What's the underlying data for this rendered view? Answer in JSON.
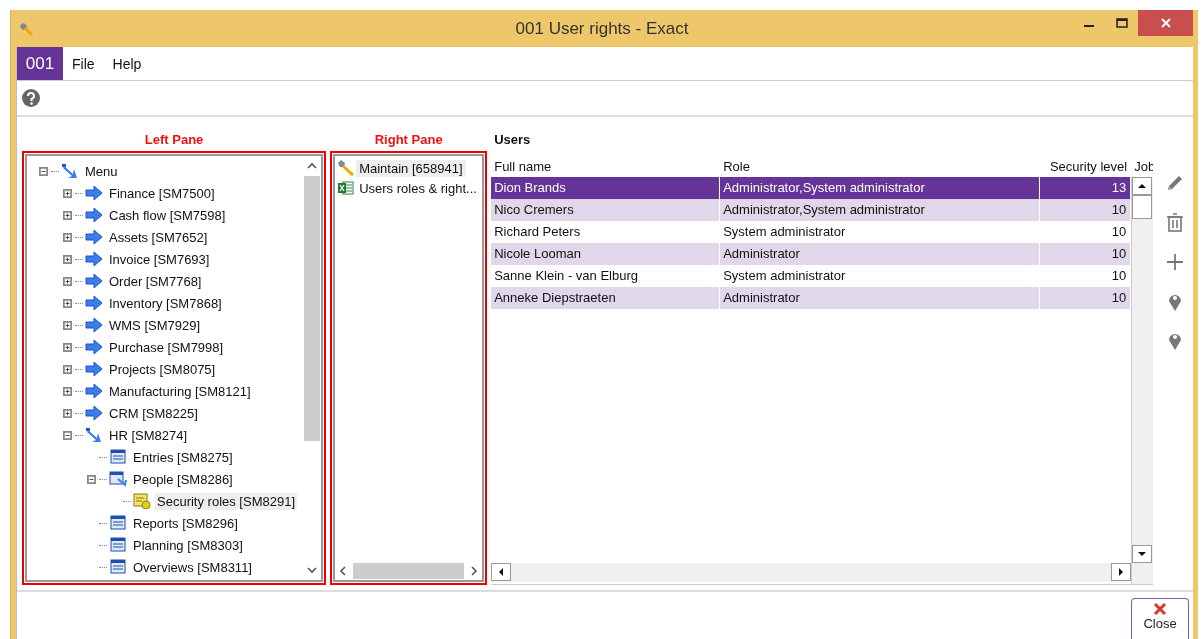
{
  "window": {
    "title": "001 User rights - Exact"
  },
  "menu_bar": {
    "company": "001",
    "items": [
      "File",
      "Help"
    ]
  },
  "pane_labels": [
    "Left Pane",
    "Right Pane"
  ],
  "tree": {
    "items": [
      {
        "label": "Menu",
        "kind": "module",
        "expanded": true,
        "selected": false,
        "children": [
          {
            "label": "Finance [SM7500]",
            "kind": "module",
            "expanded": false,
            "selected": false
          },
          {
            "label": "Cash flow [SM7598]",
            "kind": "module",
            "expanded": false,
            "selected": false
          },
          {
            "label": "Assets [SM7652]",
            "kind": "module",
            "expanded": false,
            "selected": false
          },
          {
            "label": "Invoice [SM7693]",
            "kind": "module",
            "expanded": false,
            "selected": false
          },
          {
            "label": "Order [SM7768]",
            "kind": "module",
            "expanded": false,
            "selected": false
          },
          {
            "label": "Inventory [SM7868]",
            "kind": "module",
            "expanded": false,
            "selected": false
          },
          {
            "label": "WMS [SM7929]",
            "kind": "module",
            "expanded": false,
            "selected": false
          },
          {
            "label": "Purchase [SM7998]",
            "kind": "module",
            "expanded": false,
            "selected": false
          },
          {
            "label": "Projects [SM8075]",
            "kind": "module",
            "expanded": false,
            "selected": false
          },
          {
            "label": "Manufacturing [SM8121]",
            "kind": "module",
            "expanded": false,
            "selected": false
          },
          {
            "label": "CRM [SM8225]",
            "kind": "module",
            "expanded": false,
            "selected": false
          },
          {
            "label": "HR [SM8274]",
            "kind": "module",
            "expanded": true,
            "selected": false,
            "children": [
              {
                "label": "Entries [SM8275]",
                "kind": "list",
                "selected": false
              },
              {
                "label": "People [SM8286]",
                "kind": "group",
                "expanded": true,
                "selected": false,
                "children": [
                  {
                    "label": "Security roles [SM8291]",
                    "kind": "security",
                    "selected": true
                  }
                ]
              },
              {
                "label": "Reports [SM8296]",
                "kind": "list",
                "selected": false
              },
              {
                "label": "Planning [SM8303]",
                "kind": "list",
                "selected": false
              },
              {
                "label": "Overviews [SM8311]",
                "kind": "list",
                "selected": false
              }
            ]
          }
        ]
      }
    ]
  },
  "right_pane": {
    "items": [
      {
        "label": "Maintain [658941]",
        "kind": "maintain",
        "selected": true
      },
      {
        "label": "Users roles & right...",
        "kind": "spreadsheet",
        "selected": false
      }
    ]
  },
  "users": {
    "title": "Users",
    "columns": [
      "Full name",
      "Role",
      "Security level",
      "Job"
    ],
    "rows": [
      {
        "cells": [
          "Dion Brands",
          "Administrator,System administrator",
          "13"
        ],
        "selected": true
      },
      {
        "cells": [
          "Nico Cremers",
          "Administrator,System administrator",
          "10"
        ],
        "selected": false
      },
      {
        "cells": [
          "Richard Peters",
          "System administrator",
          "10"
        ],
        "selected": false
      },
      {
        "cells": [
          "Nicole Looman",
          "Administrator",
          "10"
        ],
        "selected": false
      },
      {
        "cells": [
          "Sanne Klein - van Elburg",
          "System administrator",
          "10"
        ],
        "selected": false
      },
      {
        "cells": [
          "Anneke Diepstraeten",
          "Administrator",
          "10"
        ],
        "selected": false
      }
    ]
  },
  "close_button": {
    "label": "Close"
  }
}
